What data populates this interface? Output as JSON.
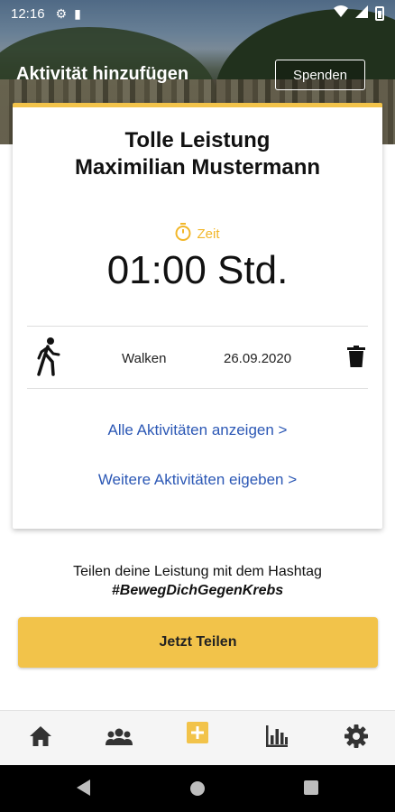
{
  "statusbar": {
    "time": "12:16"
  },
  "header": {
    "title": "Aktivität hinzufügen",
    "donate_label": "Spenden"
  },
  "card": {
    "title_line1": "Tolle Leistung",
    "title_line2": "Maximilian Mustermann",
    "time_label": "Zeit",
    "duration": "01:00 Std.",
    "activity": {
      "type": "Walken",
      "date": "26.09.2020"
    },
    "link_all": "Alle Aktivitäten anzeigen >",
    "link_more": "Weitere Aktivitäten eigeben  >"
  },
  "share": {
    "text": "Teilen deine Leistung mit dem Hashtag",
    "hashtag": "#BewegDichGegenKrebs",
    "button_label": "Jetzt Teilen"
  },
  "bottom_nav": {
    "items": [
      {
        "icon": "home-icon"
      },
      {
        "icon": "group-icon"
      },
      {
        "icon": "add-icon",
        "active": true
      },
      {
        "icon": "stats-icon"
      },
      {
        "icon": "settings-icon"
      }
    ]
  },
  "colors": {
    "accent": "#f2c34a",
    "link": "#2c58b5",
    "time_accent": "#f2b72a"
  }
}
